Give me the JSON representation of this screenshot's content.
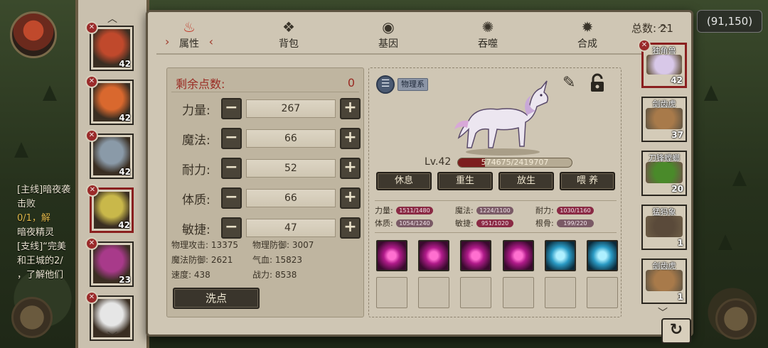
{
  "background": {
    "coords": "(91,150)",
    "quest_lines": [
      {
        "text": "[主线]暗夜袭",
        "highlight": false
      },
      {
        "text": "击败",
        "highlight": false
      },
      {
        "text": "0/1，解",
        "highlight": true
      },
      {
        "text": "暗夜精灵",
        "highlight": false
      },
      {
        "text": "[支线]“完美",
        "highlight": false
      },
      {
        "text": "和王城的2/",
        "highlight": false
      },
      {
        "text": "，了解他们",
        "highlight": false
      }
    ]
  },
  "tabs": [
    {
      "label": "属性",
      "icon": "flame-icon",
      "active": true
    },
    {
      "label": "背包",
      "icon": "bag-icon",
      "active": false
    },
    {
      "label": "基因",
      "icon": "gene-icon",
      "active": false
    },
    {
      "label": "吞噬",
      "icon": "devour-icon",
      "active": false
    },
    {
      "label": "合成",
      "icon": "merge-icon",
      "active": false
    }
  ],
  "total": "总数: 21",
  "stats_panel": {
    "remaining_label": "剩余点数:",
    "remaining_value": "0",
    "rows": [
      {
        "label": "力量:",
        "value": "267"
      },
      {
        "label": "魔法:",
        "value": "66"
      },
      {
        "label": "耐力:",
        "value": "52"
      },
      {
        "label": "体质:",
        "value": "66"
      },
      {
        "label": "敏捷:",
        "value": "47"
      }
    ],
    "minus": "−",
    "plus": "+",
    "combat": [
      [
        "物理攻击: 13375",
        "物理防御: 3007"
      ],
      [
        "魔法防御: 2621",
        "气血: 15823"
      ],
      [
        "速度: 438",
        "战力: 8538"
      ]
    ],
    "wash_button": "洗点"
  },
  "pet": {
    "type_tag": "物理系",
    "level": "Lv.42",
    "exp_text": "574675/2419707",
    "exp_fraction": 0.2375,
    "actions": [
      "休息",
      "重生",
      "放生",
      "喂 养"
    ],
    "aptitudes": [
      [
        {
          "label": "力量:",
          "value": "1511/1480"
        },
        {
          "label": "魔法:",
          "value": "1224/1100"
        },
        {
          "label": "耐力:",
          "value": "1030/1160"
        }
      ],
      [
        {
          "label": "体质:",
          "value": "1054/1240"
        },
        {
          "label": "敏捷:",
          "value": "951/1020"
        },
        {
          "label": "根骨:",
          "value": "199/220"
        }
      ]
    ],
    "skills": [
      "pink",
      "pink",
      "pink",
      "pink",
      "blue",
      "blue"
    ],
    "empty_slots": 6
  },
  "heroes": [
    {
      "level": "42",
      "selected": false,
      "color": "#c0492c"
    },
    {
      "level": "42",
      "selected": false,
      "color": "#d9682e"
    },
    {
      "level": "42",
      "selected": false,
      "color": "#8a9aa8"
    },
    {
      "level": "42",
      "selected": true,
      "color": "#c9b84a"
    },
    {
      "level": "23",
      "selected": false,
      "color": "#a83a8a"
    },
    {
      "level": "",
      "selected": false,
      "color": "#e6e6e6"
    }
  ],
  "pets": [
    {
      "name": "独角兽",
      "level": "42",
      "selected": true,
      "color": "#d8c8e8"
    },
    {
      "name": "剑齿虎",
      "level": "37",
      "selected": false,
      "color": "#a87a4a"
    },
    {
      "name": "刀锋螳螂",
      "level": "20",
      "selected": false,
      "color": "#4a8a2a"
    },
    {
      "name": "猛犸象",
      "level": "1",
      "selected": false,
      "color": "#5a4a3a"
    },
    {
      "name": "剑齿虎",
      "level": "1",
      "selected": false,
      "color": "#a87a4a"
    }
  ],
  "back_icon": "↻"
}
